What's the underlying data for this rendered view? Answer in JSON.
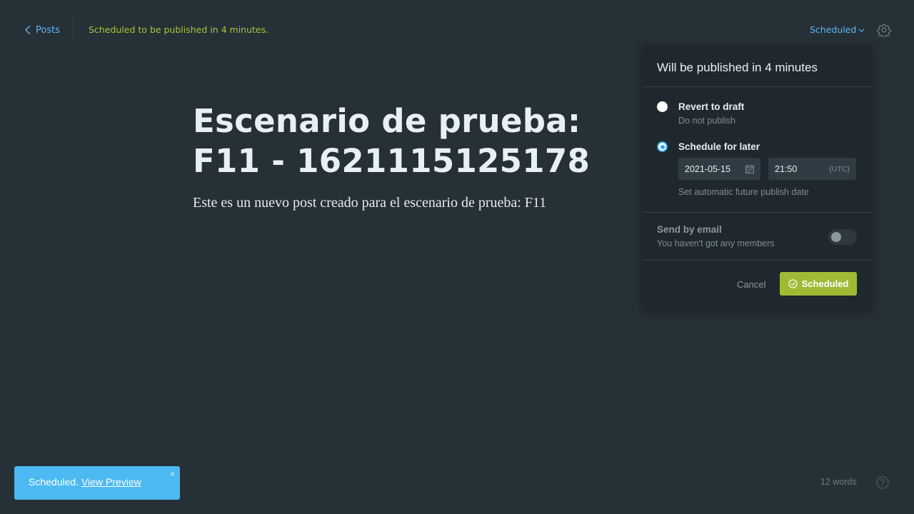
{
  "header": {
    "back_label": "Posts",
    "status_message": "Scheduled to be published in 4 minutes.",
    "publish_menu_label": "Scheduled"
  },
  "editor": {
    "title": "Escenario de prueba: F11 - 1621115125178",
    "body": "Este es un nuevo post creado para el escenario de prueba: F11"
  },
  "publish_popover": {
    "heading": "Will be published in 4 minutes",
    "options": [
      {
        "title": "Revert to draft",
        "subtitle": "Do not publish",
        "selected": false
      },
      {
        "title": "Schedule for later",
        "subtitle": "Set automatic future publish date",
        "selected": true
      }
    ],
    "date_value": "2021-05-15",
    "time_value": "21:50",
    "timezone": "(UTC)",
    "email": {
      "title": "Send by email",
      "subtitle": "You haven't got any members",
      "enabled": false
    },
    "cancel_label": "Cancel",
    "confirm_label": "Scheduled"
  },
  "toast": {
    "message": "Scheduled.",
    "link_label": "View Preview",
    "close_glyph": "×"
  },
  "footer": {
    "word_count": "12 words"
  },
  "colors": {
    "background": "#263037",
    "accent_blue": "#5bb8f5",
    "accent_green": "#a4c639",
    "button_green": "#9fbb36",
    "toast_blue": "#4cb9f2"
  }
}
